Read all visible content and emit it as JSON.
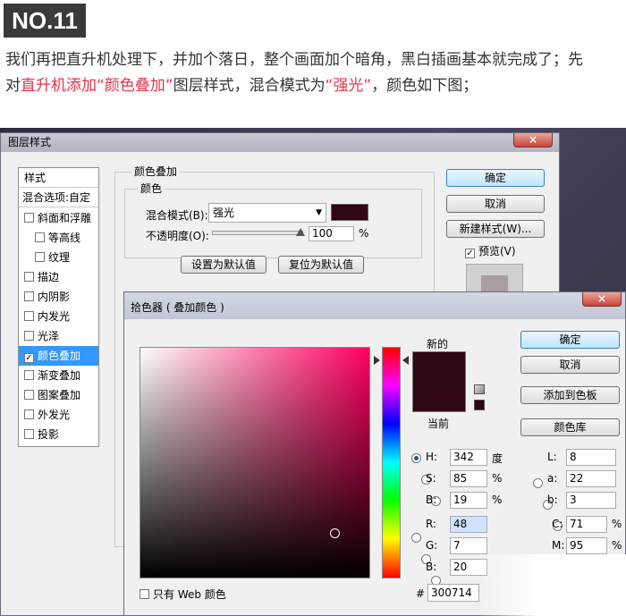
{
  "header": {
    "badge": "NO.11",
    "line1": "我们再把直升机处理下，并加个落日，整个画面加个暗角，黑白插画基本就完成了；先",
    "line2_pre": "对",
    "line2_red1": "直升机添加",
    "line2_q1": "“颜色叠加”",
    "line2_mid": "图层样式，混合模式为",
    "line2_q2": "“强光”",
    "line2_post": "，颜色如下图；"
  },
  "layer_style": {
    "title": "图层样式",
    "close": "×",
    "list_header": "样式",
    "blend_options": "混合选项:自定",
    "items": [
      {
        "label": "斜面和浮雕",
        "checked": false
      },
      {
        "label": "等高线",
        "checked": false
      },
      {
        "label": "纹理",
        "checked": false
      },
      {
        "label": "描边",
        "checked": false
      },
      {
        "label": "内阴影",
        "checked": false
      },
      {
        "label": "内发光",
        "checked": false
      },
      {
        "label": "光泽",
        "checked": false
      },
      {
        "label": "颜色叠加",
        "checked": true
      },
      {
        "label": "渐变叠加",
        "checked": false
      },
      {
        "label": "图案叠加",
        "checked": false
      },
      {
        "label": "外发光",
        "checked": false
      },
      {
        "label": "投影",
        "checked": false
      }
    ],
    "group_title": "颜色叠加",
    "subgroup_title": "颜色",
    "blend_label": "混合模式(B):",
    "blend_value": "强光",
    "opacity_label": "不透明度(O):",
    "opacity_value": "100",
    "opacity_unit": "%",
    "overlay_color": "#300714",
    "btn_make_default": "设置为默认值",
    "btn_reset_default": "复位为默认值",
    "btn_ok": "确定",
    "btn_cancel": "取消",
    "btn_new_style": "新建样式(W)...",
    "preview_label": "预览(V)",
    "preview_checked": true
  },
  "color_picker": {
    "title": "拾色器 ( 叠加颜色 )",
    "close": "×",
    "new_label": "新的",
    "current_label": "当前",
    "btn_ok": "确定",
    "btn_cancel": "取消",
    "btn_add_swatch": "添加到色板",
    "btn_libraries": "颜色库",
    "hsb": [
      {
        "key": "H:",
        "value": "342",
        "unit": "度",
        "selected": true
      },
      {
        "key": "S:",
        "value": "85",
        "unit": "%",
        "selected": false
      },
      {
        "key": "B:",
        "value": "19",
        "unit": "%",
        "selected": false
      }
    ],
    "rgb": [
      {
        "key": "R:",
        "value": "48",
        "selected": false
      },
      {
        "key": "G:",
        "value": "7",
        "selected": false
      },
      {
        "key": "B:",
        "value": "20",
        "selected": false
      }
    ],
    "lab": [
      {
        "key": "L:",
        "value": "8"
      },
      {
        "key": "a:",
        "value": "22"
      },
      {
        "key": "b:",
        "value": "3"
      }
    ],
    "cmyk": [
      {
        "key": "C:",
        "value": "71",
        "unit": "%"
      },
      {
        "key": "M:",
        "value": "95",
        "unit": "%"
      }
    ],
    "web_only": "只有 Web 颜色",
    "hex_label": "#",
    "hex_value": "300714",
    "current_color": "#300714"
  }
}
